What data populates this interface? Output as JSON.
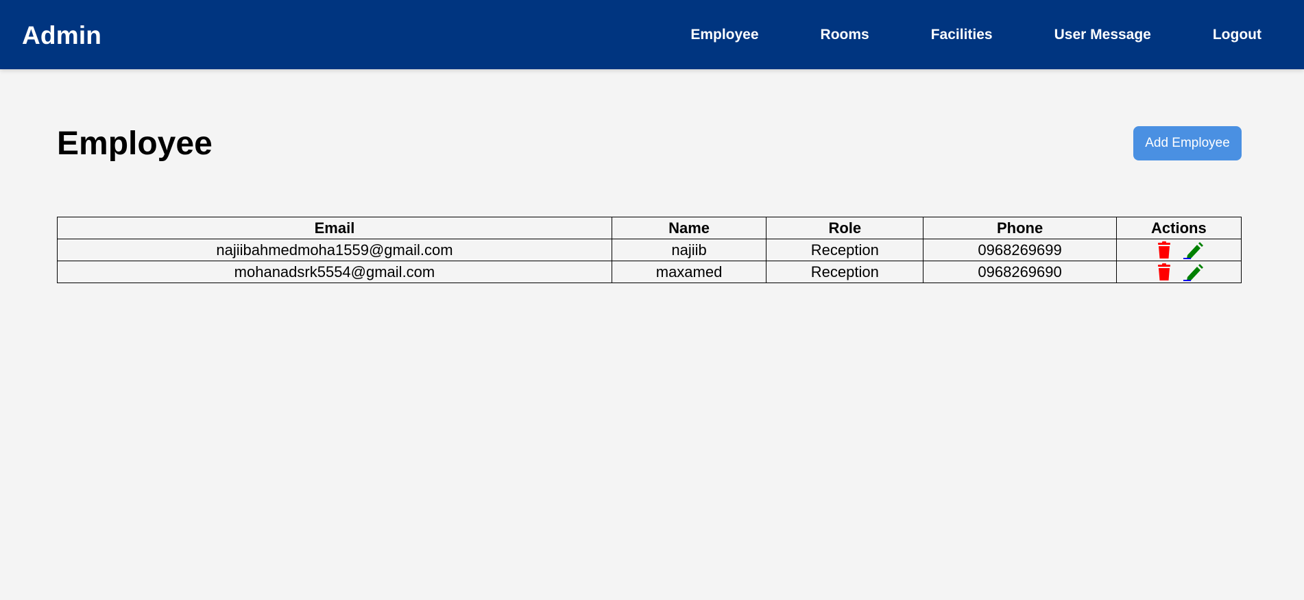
{
  "header": {
    "brand": "Admin",
    "nav": [
      {
        "label": "Employee"
      },
      {
        "label": "Rooms"
      },
      {
        "label": "Facilities"
      },
      {
        "label": "User Message"
      },
      {
        "label": "Logout"
      }
    ]
  },
  "page": {
    "title": "Employee",
    "add_button_label": "Add Employee"
  },
  "table": {
    "columns": [
      "Email",
      "Name",
      "Role",
      "Phone",
      "Actions"
    ],
    "rows": [
      {
        "email": "najiibahmedmoha1559@gmail.com",
        "name": "najiib",
        "role": "Reception",
        "phone": "0968269699"
      },
      {
        "email": "mohanadsrk5554@gmail.com",
        "name": "maxamed",
        "role": "Reception",
        "phone": "0968269690"
      }
    ],
    "actions": {
      "delete_icon": "trash-icon",
      "edit_icon": "pencil-icon"
    }
  },
  "colors": {
    "navbar": "#003580",
    "background": "#f4f4f4",
    "button": "#4a90e2",
    "delete": "#ff0000",
    "edit": "#008000",
    "edit_underline": "#0000ee"
  }
}
